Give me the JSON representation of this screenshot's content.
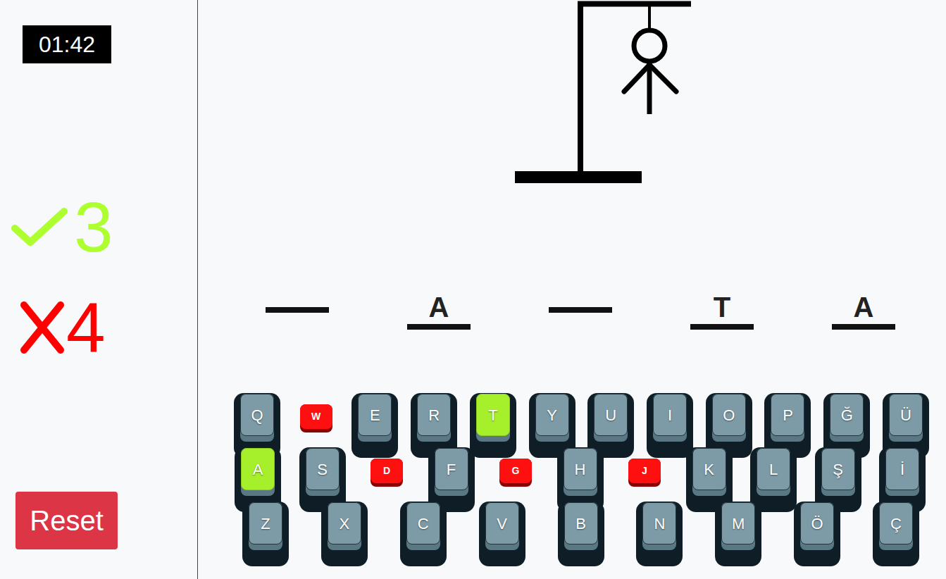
{
  "timer": "01:42",
  "score": {
    "correct": "3",
    "wrong": "4"
  },
  "reset_button": "Reset",
  "hangman": {
    "stage": 4
  },
  "word": [
    {
      "letter": "",
      "revealed": false
    },
    {
      "letter": "A",
      "revealed": true
    },
    {
      "letter": "",
      "revealed": false
    },
    {
      "letter": "T",
      "revealed": true
    },
    {
      "letter": "A",
      "revealed": true
    }
  ],
  "keyboard": [
    [
      {
        "key": "Q",
        "state": "unused"
      },
      {
        "key": "W",
        "state": "wrong"
      },
      {
        "key": "E",
        "state": "unused"
      },
      {
        "key": "R",
        "state": "unused"
      },
      {
        "key": "T",
        "state": "correct"
      },
      {
        "key": "Y",
        "state": "unused"
      },
      {
        "key": "U",
        "state": "unused"
      },
      {
        "key": "I",
        "state": "unused"
      },
      {
        "key": "O",
        "state": "unused"
      },
      {
        "key": "P",
        "state": "unused"
      },
      {
        "key": "Ğ",
        "state": "unused"
      },
      {
        "key": "Ü",
        "state": "unused"
      }
    ],
    [
      {
        "key": "A",
        "state": "correct"
      },
      {
        "key": "S",
        "state": "unused"
      },
      {
        "key": "D",
        "state": "wrong"
      },
      {
        "key": "F",
        "state": "unused"
      },
      {
        "key": "G",
        "state": "wrong"
      },
      {
        "key": "H",
        "state": "unused"
      },
      {
        "key": "J",
        "state": "wrong"
      },
      {
        "key": "K",
        "state": "unused"
      },
      {
        "key": "L",
        "state": "unused"
      },
      {
        "key": "Ş",
        "state": "unused"
      },
      {
        "key": "İ",
        "state": "unused"
      }
    ],
    [
      {
        "key": "Z",
        "state": "unused"
      },
      {
        "key": "X",
        "state": "unused"
      },
      {
        "key": "C",
        "state": "unused"
      },
      {
        "key": "V",
        "state": "unused"
      },
      {
        "key": "B",
        "state": "unused"
      },
      {
        "key": "N",
        "state": "unused"
      },
      {
        "key": "M",
        "state": "unused"
      },
      {
        "key": "Ö",
        "state": "unused"
      },
      {
        "key": "Ç",
        "state": "unused"
      }
    ]
  ]
}
